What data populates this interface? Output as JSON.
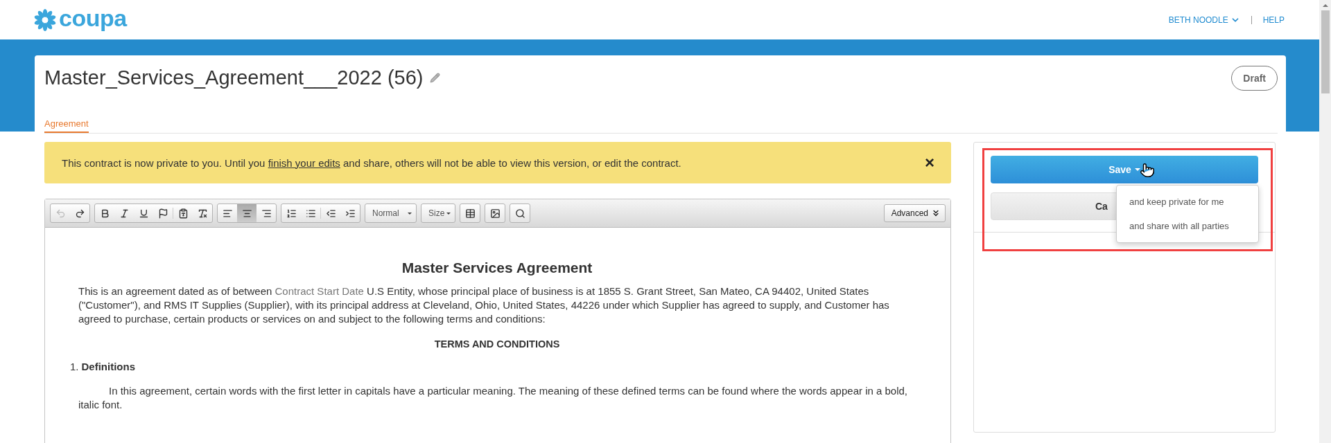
{
  "header": {
    "logo": "coupa",
    "user_menu": "BETH NOODLE",
    "help_link": "HELP"
  },
  "contract": {
    "title": "Master_Services_Agreement___2022 (56)",
    "status": "Draft"
  },
  "tabs": [
    {
      "label": "Agreement",
      "selected": true
    }
  ],
  "banner": {
    "before": "This contract is now private to you. Until you ",
    "link": "finish your edits",
    "after": " and share, others will not be able to view this version, or edit the contract.",
    "close": "×"
  },
  "toolbar": {
    "buttons": [
      {
        "disabled": true,
        "selected": false
      },
      {
        "disabled": false,
        "selected": false
      },
      {
        "disabled": false,
        "selected": false
      },
      {
        "disabled": false,
        "selected": false
      },
      {
        "disabled": false,
        "selected": false
      },
      {
        "disabled": false,
        "selected": false
      },
      {
        "disabled": false,
        "selected": false
      },
      {
        "disabled": false,
        "selected": false
      },
      {
        "disabled": false,
        "selected": false
      },
      {
        "disabled": false,
        "selected": true
      },
      {
        "disabled": false,
        "selected": false
      },
      {
        "disabled": false,
        "selected": false
      },
      {
        "disabled": false,
        "selected": false
      },
      {
        "disabled": false,
        "selected": false
      },
      {
        "disabled": false,
        "selected": false
      },
      {
        "disabled": false,
        "selected": false
      },
      {
        "disabled": false,
        "selected": false
      },
      {
        "disabled": false,
        "selected": false
      }
    ],
    "format_select": "Normal",
    "size_select": "Size",
    "advanced_button": "Advanced"
  },
  "document": {
    "heading": "Master Services Agreement",
    "intro": [
      {
        "kind": "plain",
        "text": "This is an agreement dated as of between "
      },
      {
        "kind": "merge_field",
        "text": "Contract Start Date"
      },
      {
        "kind": "plain",
        "text": " U.S Entity, whose principal place of business is at 1855 S. Grant Street, San Mateo, CA 94402, United States (\"Customer\"), and  RMS IT Supplies (Supplier), with its principal address at Cleveland, Ohio, United States, 44226 under which Supplier has agreed to supply, and Customer has agreed to purchase, certain products or services on and subject to the following terms and conditions:"
      }
    ],
    "section_heading": "TERMS AND CONDITIONS",
    "clauses": [
      {
        "number": "1.",
        "title": "Definitions",
        "body": "In this agreement, certain words with the first letter in capitals have a particular meaning.  The meaning of these defined terms can be found where the words appear in a bold, italic font."
      }
    ]
  },
  "actions": {
    "highlighted": true,
    "save_button": "Save",
    "cancel_button": "Ca",
    "save_menu": {
      "expanded": true,
      "items": [
        "and keep private for me",
        "and share with all parties"
      ]
    }
  }
}
